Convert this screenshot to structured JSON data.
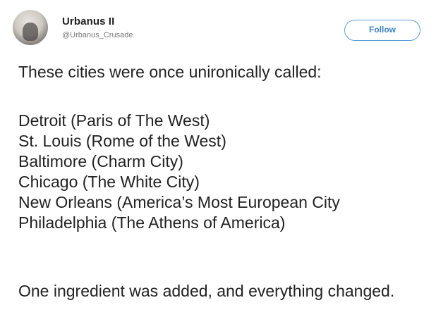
{
  "author": {
    "name": "Urbanus II",
    "handle": "@Urbanus_Crusade",
    "avatar_icon": "profile-photo"
  },
  "follow_button": {
    "label": "Follow",
    "color": "#3b82c4"
  },
  "tweet": {
    "intro": "These cities were once unironically called:",
    "cities": [
      "Detroit (Paris of The West)",
      "St. Louis (Rome of the West)",
      "Baltimore (Charm City)",
      "Chicago (The White City)",
      "New Orleans (America’s Most European City",
      "Philadelphia (The Athens of America)"
    ],
    "outro": "One ingredient was added, and everything changed."
  }
}
